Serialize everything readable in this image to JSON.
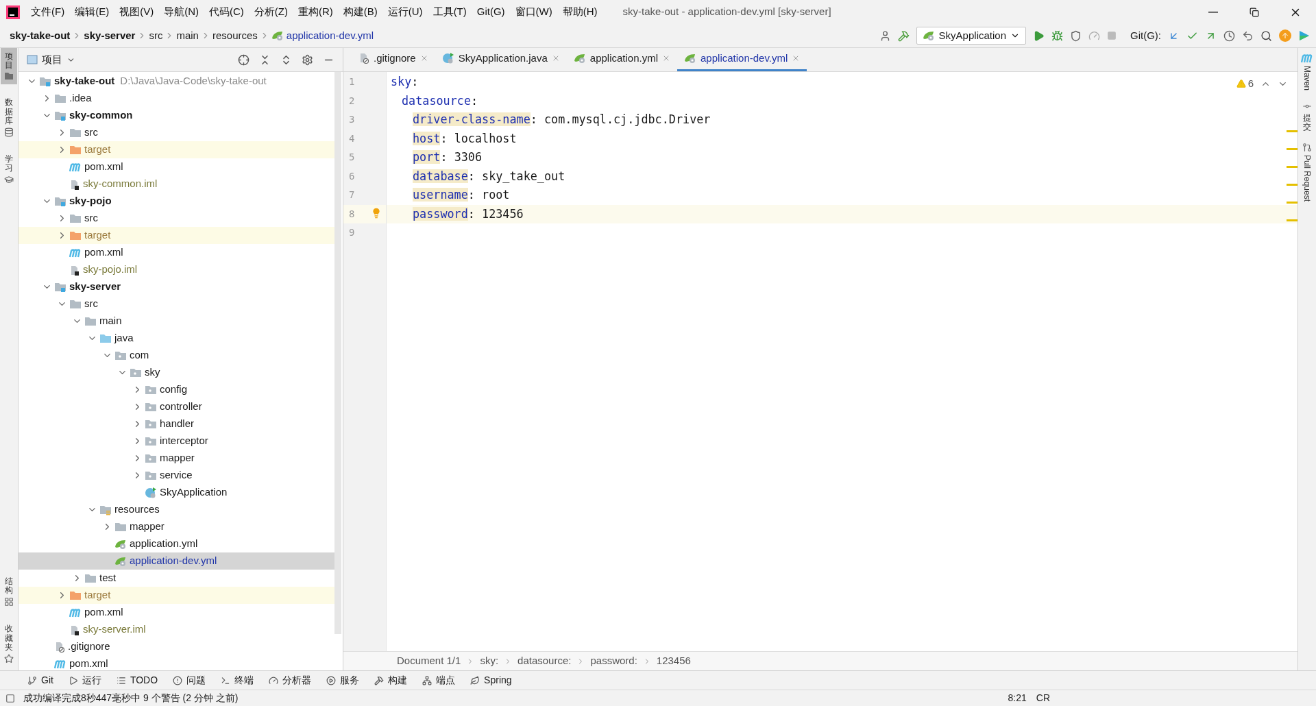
{
  "window": {
    "title": "sky-take-out - application-dev.yml [sky-server]"
  },
  "menu": [
    "文件(F)",
    "编辑(E)",
    "视图(V)",
    "导航(N)",
    "代码(C)",
    "分析(Z)",
    "重构(R)",
    "构建(B)",
    "运行(U)",
    "工具(T)",
    "Git(G)",
    "窗口(W)",
    "帮助(H)"
  ],
  "breadcrumb": [
    {
      "label": "sky-take-out",
      "kind": "module"
    },
    {
      "label": "sky-server",
      "kind": "module"
    },
    {
      "label": "src",
      "kind": "folder"
    },
    {
      "label": "main",
      "kind": "folder"
    },
    {
      "label": "resources",
      "kind": "folder"
    },
    {
      "label": "application-dev.yml",
      "kind": "file"
    }
  ],
  "toolbar": {
    "run_config": "SkyApplication",
    "git_label": "Git(G):"
  },
  "left_strip": {
    "top": [
      {
        "label": "项目",
        "selected": true,
        "kind": "folder"
      },
      {
        "label": "数据库",
        "selected": false,
        "kind": "database"
      },
      {
        "label": "学习",
        "selected": false,
        "kind": "learn"
      }
    ],
    "bottom": [
      {
        "label": "结构",
        "selected": false,
        "kind": "structure"
      },
      {
        "label": "收藏夹",
        "selected": false,
        "kind": "star"
      }
    ]
  },
  "right_strip": [
    {
      "label": "Maven",
      "kind": "maven"
    },
    {
      "label": "提交",
      "kind": "commit"
    },
    {
      "label": "Pull Request",
      "kind": "pull"
    }
  ],
  "project_panel": {
    "title": "项目",
    "tree": [
      {
        "name": "sky-take-out",
        "path": "D:\\Java\\Java-Code\\sky-take-out",
        "kind": "module",
        "expanded": true,
        "selected": false,
        "children": [
          {
            "name": ".idea",
            "kind": "folder",
            "expanded": false,
            "selected": false
          },
          {
            "name": "sky-common",
            "kind": "module",
            "expanded": true,
            "selected": false,
            "children": [
              {
                "name": "src",
                "kind": "folder",
                "expanded": false,
                "selected": false
              },
              {
                "name": "target",
                "kind": "excluded",
                "expanded": false,
                "selected": false
              },
              {
                "name": "pom.xml",
                "kind": "maven",
                "selected": false
              },
              {
                "name": "sky-common.iml",
                "kind": "iml",
                "selected": false
              }
            ]
          },
          {
            "name": "sky-pojo",
            "kind": "module",
            "expanded": true,
            "selected": false,
            "children": [
              {
                "name": "src",
                "kind": "folder",
                "expanded": false,
                "selected": false
              },
              {
                "name": "target",
                "kind": "excluded",
                "expanded": false,
                "selected": false
              },
              {
                "name": "pom.xml",
                "kind": "maven",
                "selected": false
              },
              {
                "name": "sky-pojo.iml",
                "kind": "iml",
                "selected": false
              }
            ]
          },
          {
            "name": "sky-server",
            "kind": "module",
            "expanded": true,
            "selected": false,
            "children": [
              {
                "name": "src",
                "kind": "folder",
                "expanded": true,
                "selected": false,
                "children": [
                  {
                    "name": "main",
                    "kind": "folder",
                    "expanded": true,
                    "selected": false,
                    "children": [
                      {
                        "name": "java",
                        "kind": "source",
                        "expanded": true,
                        "selected": false,
                        "children": [
                          {
                            "name": "com",
                            "kind": "package",
                            "expanded": true,
                            "selected": false,
                            "children": [
                              {
                                "name": "sky",
                                "kind": "package",
                                "expanded": true,
                                "selected": false,
                                "children": [
                                  {
                                    "name": "config",
                                    "kind": "package",
                                    "expanded": false,
                                    "selected": false
                                  },
                                  {
                                    "name": "controller",
                                    "kind": "package",
                                    "expanded": false,
                                    "selected": false
                                  },
                                  {
                                    "name": "handler",
                                    "kind": "package",
                                    "expanded": false,
                                    "selected": false
                                  },
                                  {
                                    "name": "interceptor",
                                    "kind": "package",
                                    "expanded": false,
                                    "selected": false
                                  },
                                  {
                                    "name": "mapper",
                                    "kind": "package",
                                    "expanded": false,
                                    "selected": false
                                  },
                                  {
                                    "name": "service",
                                    "kind": "package",
                                    "expanded": false,
                                    "selected": false
                                  },
                                  {
                                    "name": "SkyApplication",
                                    "kind": "class",
                                    "selected": false
                                  }
                                ]
                              }
                            ]
                          }
                        ]
                      },
                      {
                        "name": "resources",
                        "kind": "resources",
                        "expanded": true,
                        "selected": false,
                        "children": [
                          {
                            "name": "mapper",
                            "kind": "folder",
                            "expanded": false,
                            "selected": false
                          },
                          {
                            "name": "application.yml",
                            "kind": "yml",
                            "selected": false
                          },
                          {
                            "name": "application-dev.yml",
                            "kind": "yml",
                            "selected": true
                          }
                        ]
                      }
                    ]
                  },
                  {
                    "name": "test",
                    "kind": "folder",
                    "expanded": false,
                    "selected": false
                  }
                ]
              },
              {
                "name": "target",
                "kind": "excluded",
                "expanded": false,
                "selected": false
              },
              {
                "name": "pom.xml",
                "kind": "maven",
                "selected": false
              },
              {
                "name": "sky-server.iml",
                "kind": "iml",
                "selected": false
              }
            ]
          },
          {
            "name": ".gitignore",
            "kind": "git",
            "selected": false
          },
          {
            "name": "pom.xml",
            "kind": "maven",
            "selected": false
          }
        ]
      }
    ]
  },
  "editor": {
    "tabs": [
      {
        "label": ".gitignore",
        "kind": "git",
        "selected": false
      },
      {
        "label": "SkyApplication.java",
        "kind": "class",
        "selected": false
      },
      {
        "label": "application.yml",
        "kind": "yml",
        "selected": false
      },
      {
        "label": "application-dev.yml",
        "kind": "yml",
        "selected": true
      }
    ],
    "line_numbers": [
      "1",
      "2",
      "3",
      "4",
      "5",
      "6",
      "7",
      "8",
      "9"
    ],
    "code": [
      {
        "key": "sky",
        "value": ":",
        "children": [
          {
            "key": "datasource",
            "value": ":",
            "children": [
              {
                "key": "driver-class-name",
                "value": ": com.mysql.cj.jdbc.Driver",
                "current": false
              },
              {
                "key": "host",
                "value": ": localhost",
                "current": false
              },
              {
                "key": "port",
                "value": ": 3306",
                "current": false
              },
              {
                "key": "database",
                "value": ": sky_take_out",
                "current": false
              },
              {
                "key": "username",
                "value": ": root",
                "current": false
              },
              {
                "key": "password",
                "value": ": 123456",
                "current": true
              }
            ]
          }
        ]
      }
    ],
    "warnings": "6",
    "path": [
      "Document 1/1",
      "sky:",
      "datasource:",
      "password:",
      "123456"
    ]
  },
  "bottom_tools": [
    {
      "label": "Git",
      "kind": "git"
    },
    {
      "label": "运行",
      "kind": "run"
    },
    {
      "label": "TODO",
      "kind": "todo"
    },
    {
      "label": "问题",
      "kind": "problems"
    },
    {
      "label": "终端",
      "kind": "terminal"
    },
    {
      "label": "分析器",
      "kind": "profiler"
    },
    {
      "label": "服务",
      "kind": "services"
    },
    {
      "label": "构建",
      "kind": "build"
    },
    {
      "label": "端点",
      "kind": "endpoints"
    },
    {
      "label": "Spring",
      "kind": "spring"
    }
  ],
  "status_bar": {
    "message": "成功编译完成8秒447毫秒中 9 个警告 (2 分钟 之前)",
    "position": "8:21",
    "line_separator": "CR"
  }
}
